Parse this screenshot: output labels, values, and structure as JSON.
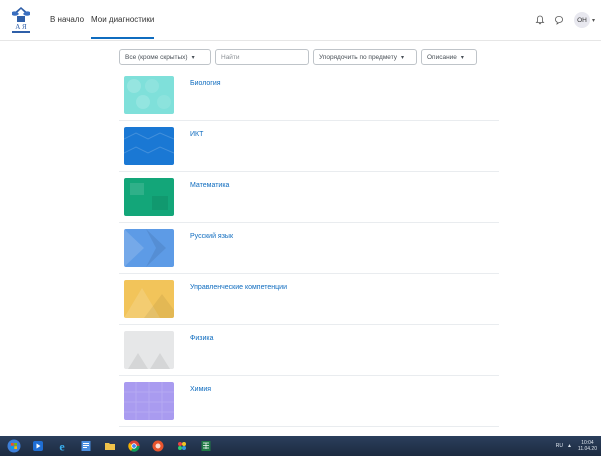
{
  "navbar": {
    "home_label": "В начало",
    "active_label": "Мои диагностики",
    "user_initials": "ОН"
  },
  "filters": {
    "grouping": "Все (кроме скрытых)",
    "search_placeholder": "Найти",
    "sort": "Упорядочить по предмету",
    "view": "Описание"
  },
  "courses": [
    {
      "name": "Биология",
      "color": "#7fe0da"
    },
    {
      "name": "ИКТ",
      "color": "#1a78d4"
    },
    {
      "name": "Математика",
      "color": "#13a679"
    },
    {
      "name": "Русский язык",
      "color": "#5d9be6"
    },
    {
      "name": "Управленческие компетенции",
      "color": "#f2c45a"
    },
    {
      "name": "Физика",
      "color": "#e6e7e8"
    },
    {
      "name": "Химия",
      "color": "#a99bf0"
    }
  ],
  "taskbar": {
    "language": "RU",
    "time": "10:04",
    "date": "11.04.20"
  }
}
